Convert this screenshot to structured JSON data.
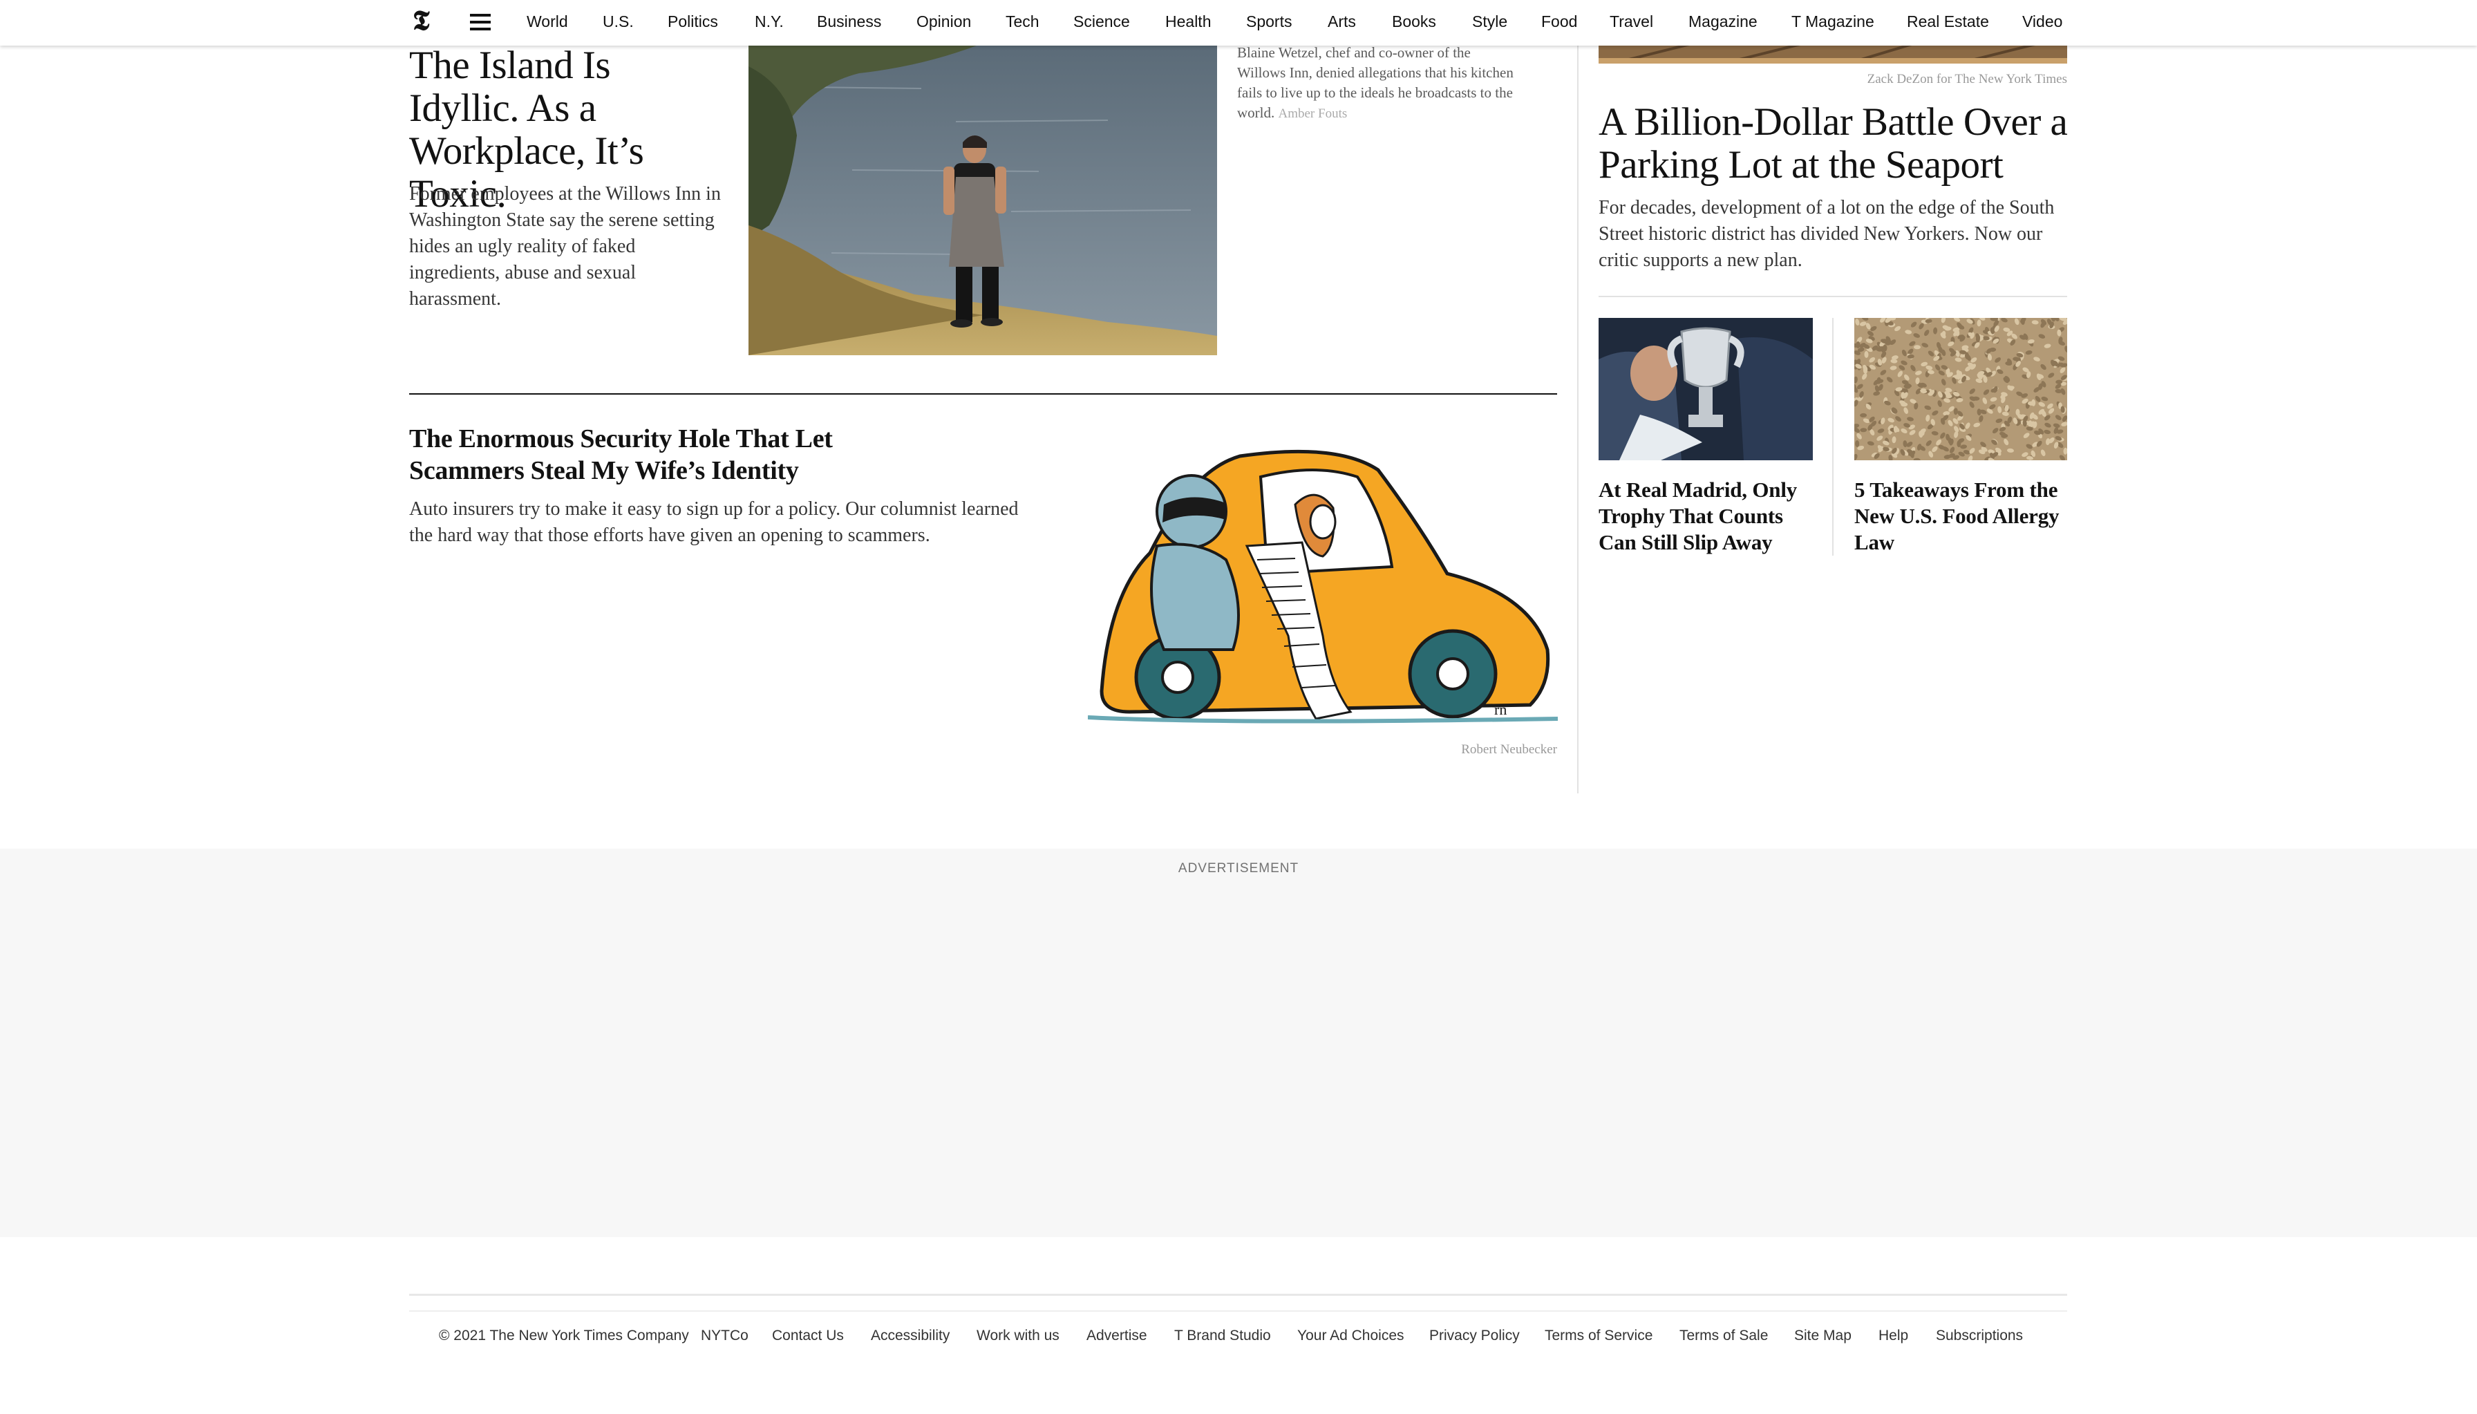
{
  "nav": {
    "logo": "𝕿",
    "items": [
      "World",
      "U.S.",
      "Politics",
      "N.Y.",
      "Business",
      "Opinion",
      "Tech",
      "Science",
      "Health",
      "Sports",
      "Arts",
      "Books",
      "Style",
      "Food",
      "Travel",
      "Magazine",
      "T Magazine",
      "Real Estate",
      "Video"
    ]
  },
  "story1": {
    "headline": "The Island Is Idyllic. As a Workplace, It’s Toxic.",
    "summary": "Former employees at the Willows Inn in Washington State say the serene setting hides an ugly reality of faked ingredients, abuse and sexual harassment.",
    "caption": "Blaine Wetzel, chef and co-owner of the Willows Inn, denied allegations that his kitchen fails to live up to the ideals he broadcasts to the world.",
    "caption_credit": "Amber Fouts"
  },
  "story2": {
    "headline": "The Enormous Security Hole That Let Scammers Steal My Wife’s Identity",
    "summary": "Auto insurers try to make it easy to sign up for a policy. Our columnist learned the hard way that those efforts have given an opening to scammers.",
    "credit": "Robert Neubecker",
    "signature": "rn"
  },
  "story3": {
    "credit": "Zack DeZon for The New York Times",
    "headline": "A Billion-Dollar Battle Over a Parking Lot at the Seaport",
    "summary": "For decades, development of a lot on the edge of the South Street historic district has divided New Yorkers. Now our critic supports a new plan."
  },
  "story4": {
    "headline": "At Real Madrid, Only Trophy That Counts Can Still Slip Away"
  },
  "story5": {
    "headline": "5 Takeaways From the New U.S. Food Allergy Law"
  },
  "ad": {
    "label": "ADVERTISEMENT"
  },
  "footer": {
    "copyright": "© 2021 The New York Times Company",
    "links": [
      "NYTCo",
      "Contact Us",
      "Accessibility",
      "Work with us",
      "Advertise",
      "T Brand Studio",
      "Your Ad Choices",
      "Privacy Policy",
      "Terms of Service",
      "Terms of Sale",
      "Site Map",
      "Help",
      "Subscriptions"
    ]
  },
  "colors": {
    "ad_background": "#f7f7f7",
    "taxi": "#f5a623",
    "water": "#6f7f8c",
    "grass": "#b89b55"
  }
}
